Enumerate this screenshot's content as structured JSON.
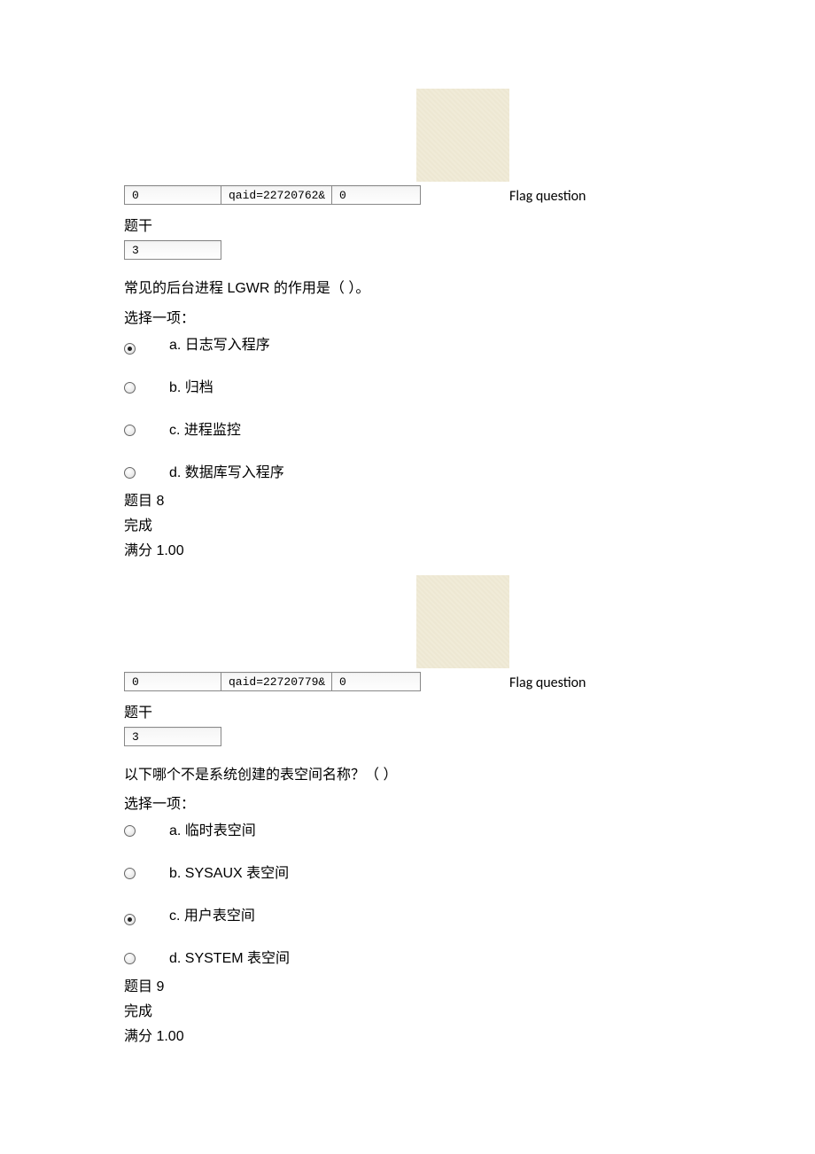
{
  "q7": {
    "flag_label": "Flag question",
    "input1": "0",
    "input2": "qaid=22720762&",
    "input3": "0",
    "title_label": "题干",
    "input_single": "3",
    "question": "常见的后台进程 LGWR 的作用是（ ）。",
    "choose_one": "选择一项：",
    "options": [
      {
        "label": "a.  日志写入程序",
        "selected": true
      },
      {
        "label": "b.  归档",
        "selected": false
      },
      {
        "label": "c.  进程监控",
        "selected": false
      },
      {
        "label": "d.  数据库写入程序",
        "selected": false
      }
    ]
  },
  "q8": {
    "header_num": "题目 8",
    "header_status": "完成",
    "header_score": "满分 1.00",
    "flag_label": "Flag question",
    "input1": "0",
    "input2": "qaid=22720779&",
    "input3": "0",
    "title_label": "题干",
    "input_single": "3",
    "question": "以下哪个不是系统创建的表空间名称？（ ）",
    "choose_one": "选择一项：",
    "options": [
      {
        "label": "a.  临时表空间",
        "selected": false
      },
      {
        "label": "b. SYSAUX 表空间",
        "selected": false
      },
      {
        "label": "c.  用户表空间",
        "selected": true
      },
      {
        "label": "d. SYSTEM 表空间",
        "selected": false
      }
    ]
  },
  "q9": {
    "header_num": "题目 9",
    "header_status": "完成",
    "header_score": "满分 1.00"
  }
}
